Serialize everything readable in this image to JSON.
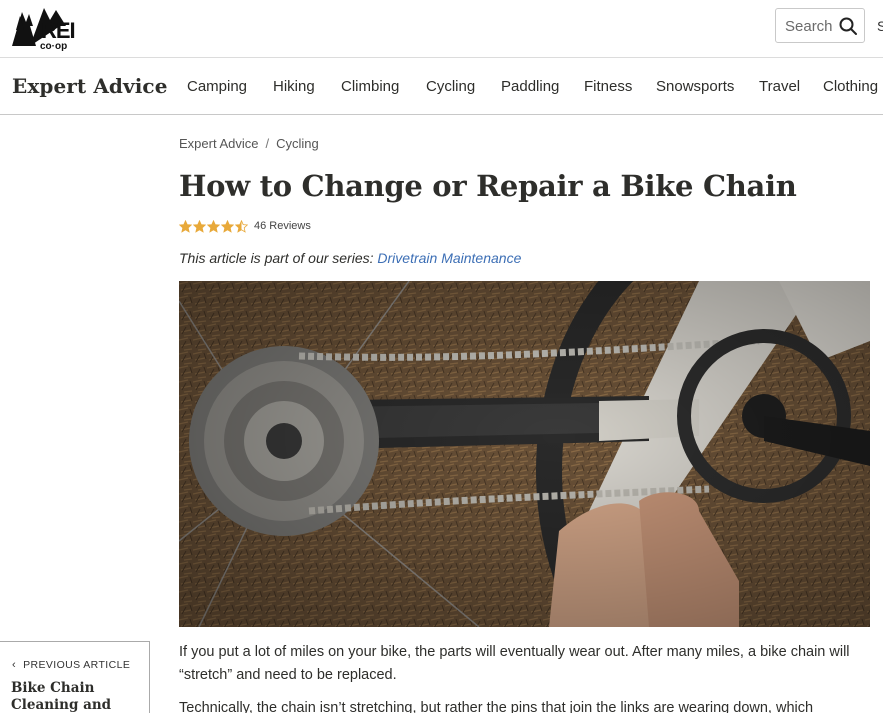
{
  "header": {
    "logo_alt": "REI co-op",
    "search_placeholder": "Search",
    "cut_off_link": "S"
  },
  "nav": {
    "brand": "Expert Advice",
    "items": [
      {
        "label": "Camping"
      },
      {
        "label": "Hiking"
      },
      {
        "label": "Climbing"
      },
      {
        "label": "Cycling"
      },
      {
        "label": "Paddling"
      },
      {
        "label": "Fitness"
      },
      {
        "label": "Snowsports"
      },
      {
        "label": "Travel"
      },
      {
        "label": "Clothing"
      }
    ]
  },
  "breadcrumb": {
    "items": [
      "Expert Advice",
      "Cycling"
    ],
    "separator": "/"
  },
  "article": {
    "title": "How to Change or Repair a Bike Chain",
    "rating_value": 4.5,
    "rating_max": 5,
    "reviews_label": "46 Reviews",
    "series_prefix": "This article is part of our series: ",
    "series_link": "Drivetrain Maintenance",
    "paragraphs": [
      "If you put a lot of miles on your bike, the parts will eventually wear out. After many miles, a bike chain will “stretch” and need to be replaced.",
      "Technically, the chain isn’t stretching, but rather the pins that join the links are wearing down, which"
    ]
  },
  "previous_article": {
    "label": "PREVIOUS ARTICLE",
    "title": "Bike Chain Cleaning and"
  },
  "colors": {
    "text": "#2e2e2b",
    "link": "#3d6fb5",
    "star": "#e8a93a"
  }
}
